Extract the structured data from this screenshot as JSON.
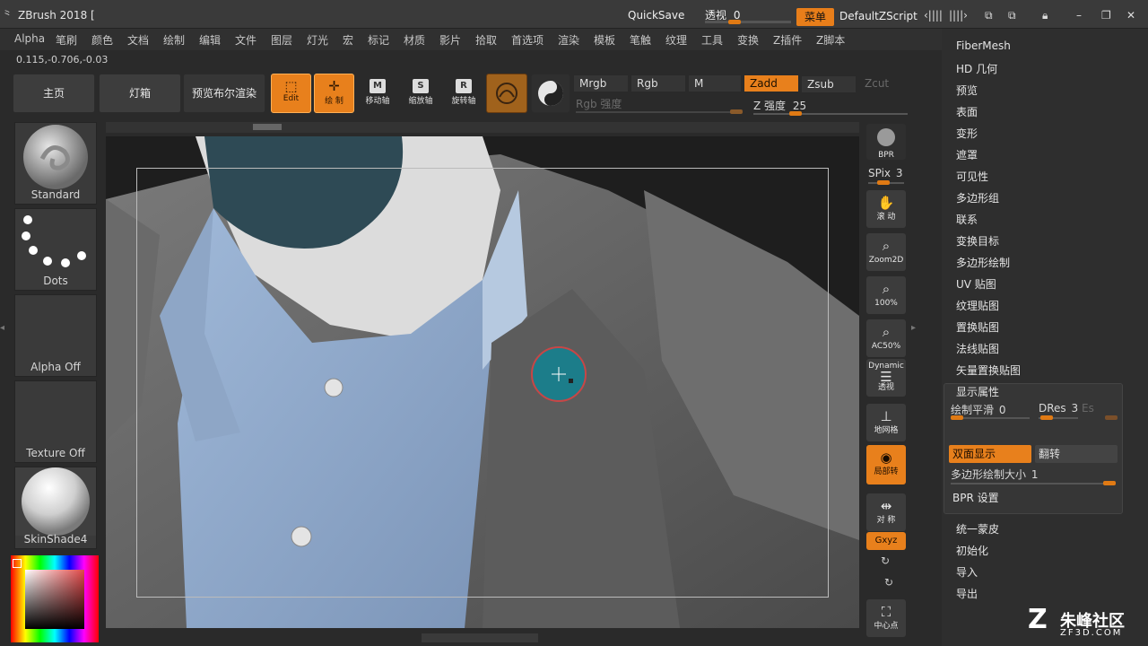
{
  "titlebar": {
    "app_title": "ZBrush 2018 [",
    "quicksave": "QuickSave",
    "perspective_label": "透视",
    "perspective_value": "0",
    "menu_label": "菜单",
    "script_label": "DefaultZScript",
    "controls": [
      "‹||||",
      "||||›",
      "⧉",
      "⧉",
      "🔒",
      "✕",
      "❐",
      "✕"
    ]
  },
  "menubar": {
    "items": [
      "Alpha",
      "笔刷",
      "颜色",
      "文档",
      "绘制",
      "编辑",
      "文件",
      "图层",
      "灯光",
      "宏",
      "标记",
      "材质",
      "影片",
      "拾取",
      "首选项",
      "渲染",
      "模板",
      "笔触",
      "纹理",
      "工具",
      "变换",
      "Z插件",
      "Z脚本"
    ]
  },
  "coords": "0.115,-0.706,-0.03",
  "toolbar": {
    "home": "主页",
    "lightbox": "灯箱",
    "bool_render": "预览布尔渲染",
    "edit": "Edit",
    "draw": "绘 制",
    "move": "移动轴",
    "scale": "缩放轴",
    "rotate": "旋转轴",
    "mrgb": "Mrgb",
    "rgb": "Rgb",
    "m": "M",
    "zadd": "Zadd",
    "zsub": "Zsub",
    "zcut": "Zcut",
    "rgb_intensity": "Rgb 强度",
    "z_intensity_label": "Z 强度",
    "z_intensity_value": "25",
    "z_intensity_fraction": 0.25
  },
  "left_shelf": {
    "brush": "Standard",
    "stroke": "Dots",
    "alpha": "Alpha Off",
    "texture": "Texture Off",
    "material": "SkinShade4"
  },
  "right_shelf": {
    "bpr": "BPR",
    "spix_label": "SPix",
    "spix_value": "3",
    "scroll": "滚 动",
    "zoom2d": "Zoom2D",
    "zoom100": "100%",
    "ac50": "AC50%",
    "persp_top": "Dynamic",
    "persp": "透视",
    "floor": "地网格",
    "polyframe": "局部转",
    "sym": "对 称",
    "xyz": "Gxyz",
    "center": "中心点"
  },
  "right_panel": {
    "items": [
      "FiberMesh",
      "HD 几何",
      "预览",
      "表面",
      "变形",
      "遮罩",
      "可见性",
      "多边形组",
      "联系",
      "变换目标",
      "多边形绘制",
      "UV 贴图",
      "纹理贴图",
      "置换贴图",
      "法线贴图",
      "矢量置换贴图"
    ],
    "display_props": "显示属性",
    "draw_smooth_label": "绘制平滑",
    "draw_smooth_value": "0",
    "dres_label": "DRes",
    "dres_value": "3",
    "es_label": "Es",
    "double_sided": "双面显示",
    "flip": "翻转",
    "polypaint_size_label": "多边形绘制大小",
    "polypaint_size_value": "1",
    "bpr_settings": "BPR 设置",
    "bottom_items": [
      "统一蒙皮",
      "初始化",
      "导入",
      "导出"
    ]
  },
  "watermark": {
    "brand": "朱峰社区",
    "url": "ZF3D.COM"
  },
  "colors": {
    "accent": "#e8801c",
    "bg": "#2a2a2a"
  }
}
